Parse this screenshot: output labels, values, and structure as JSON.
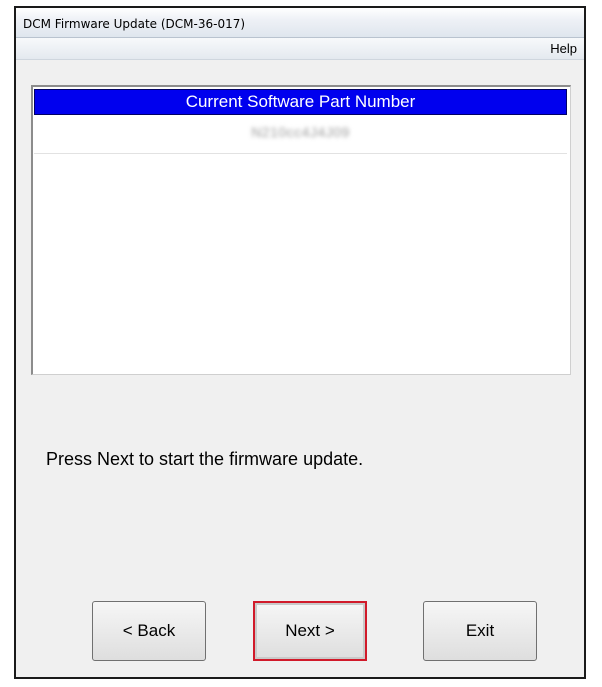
{
  "window": {
    "title": "DCM Firmware Update (DCM-36-017)"
  },
  "menubar": {
    "help_label": "Help"
  },
  "grid": {
    "header": "Current Software Part Number",
    "rows": [
      "N210cc4J4J09"
    ]
  },
  "message": "Press Next to start the firmware update.",
  "buttons": {
    "back_label": "< Back",
    "next_label": "Next >",
    "exit_label": "Exit"
  },
  "colors": {
    "header_background": "#0000ee",
    "highlight_border": "#d11a2a"
  }
}
